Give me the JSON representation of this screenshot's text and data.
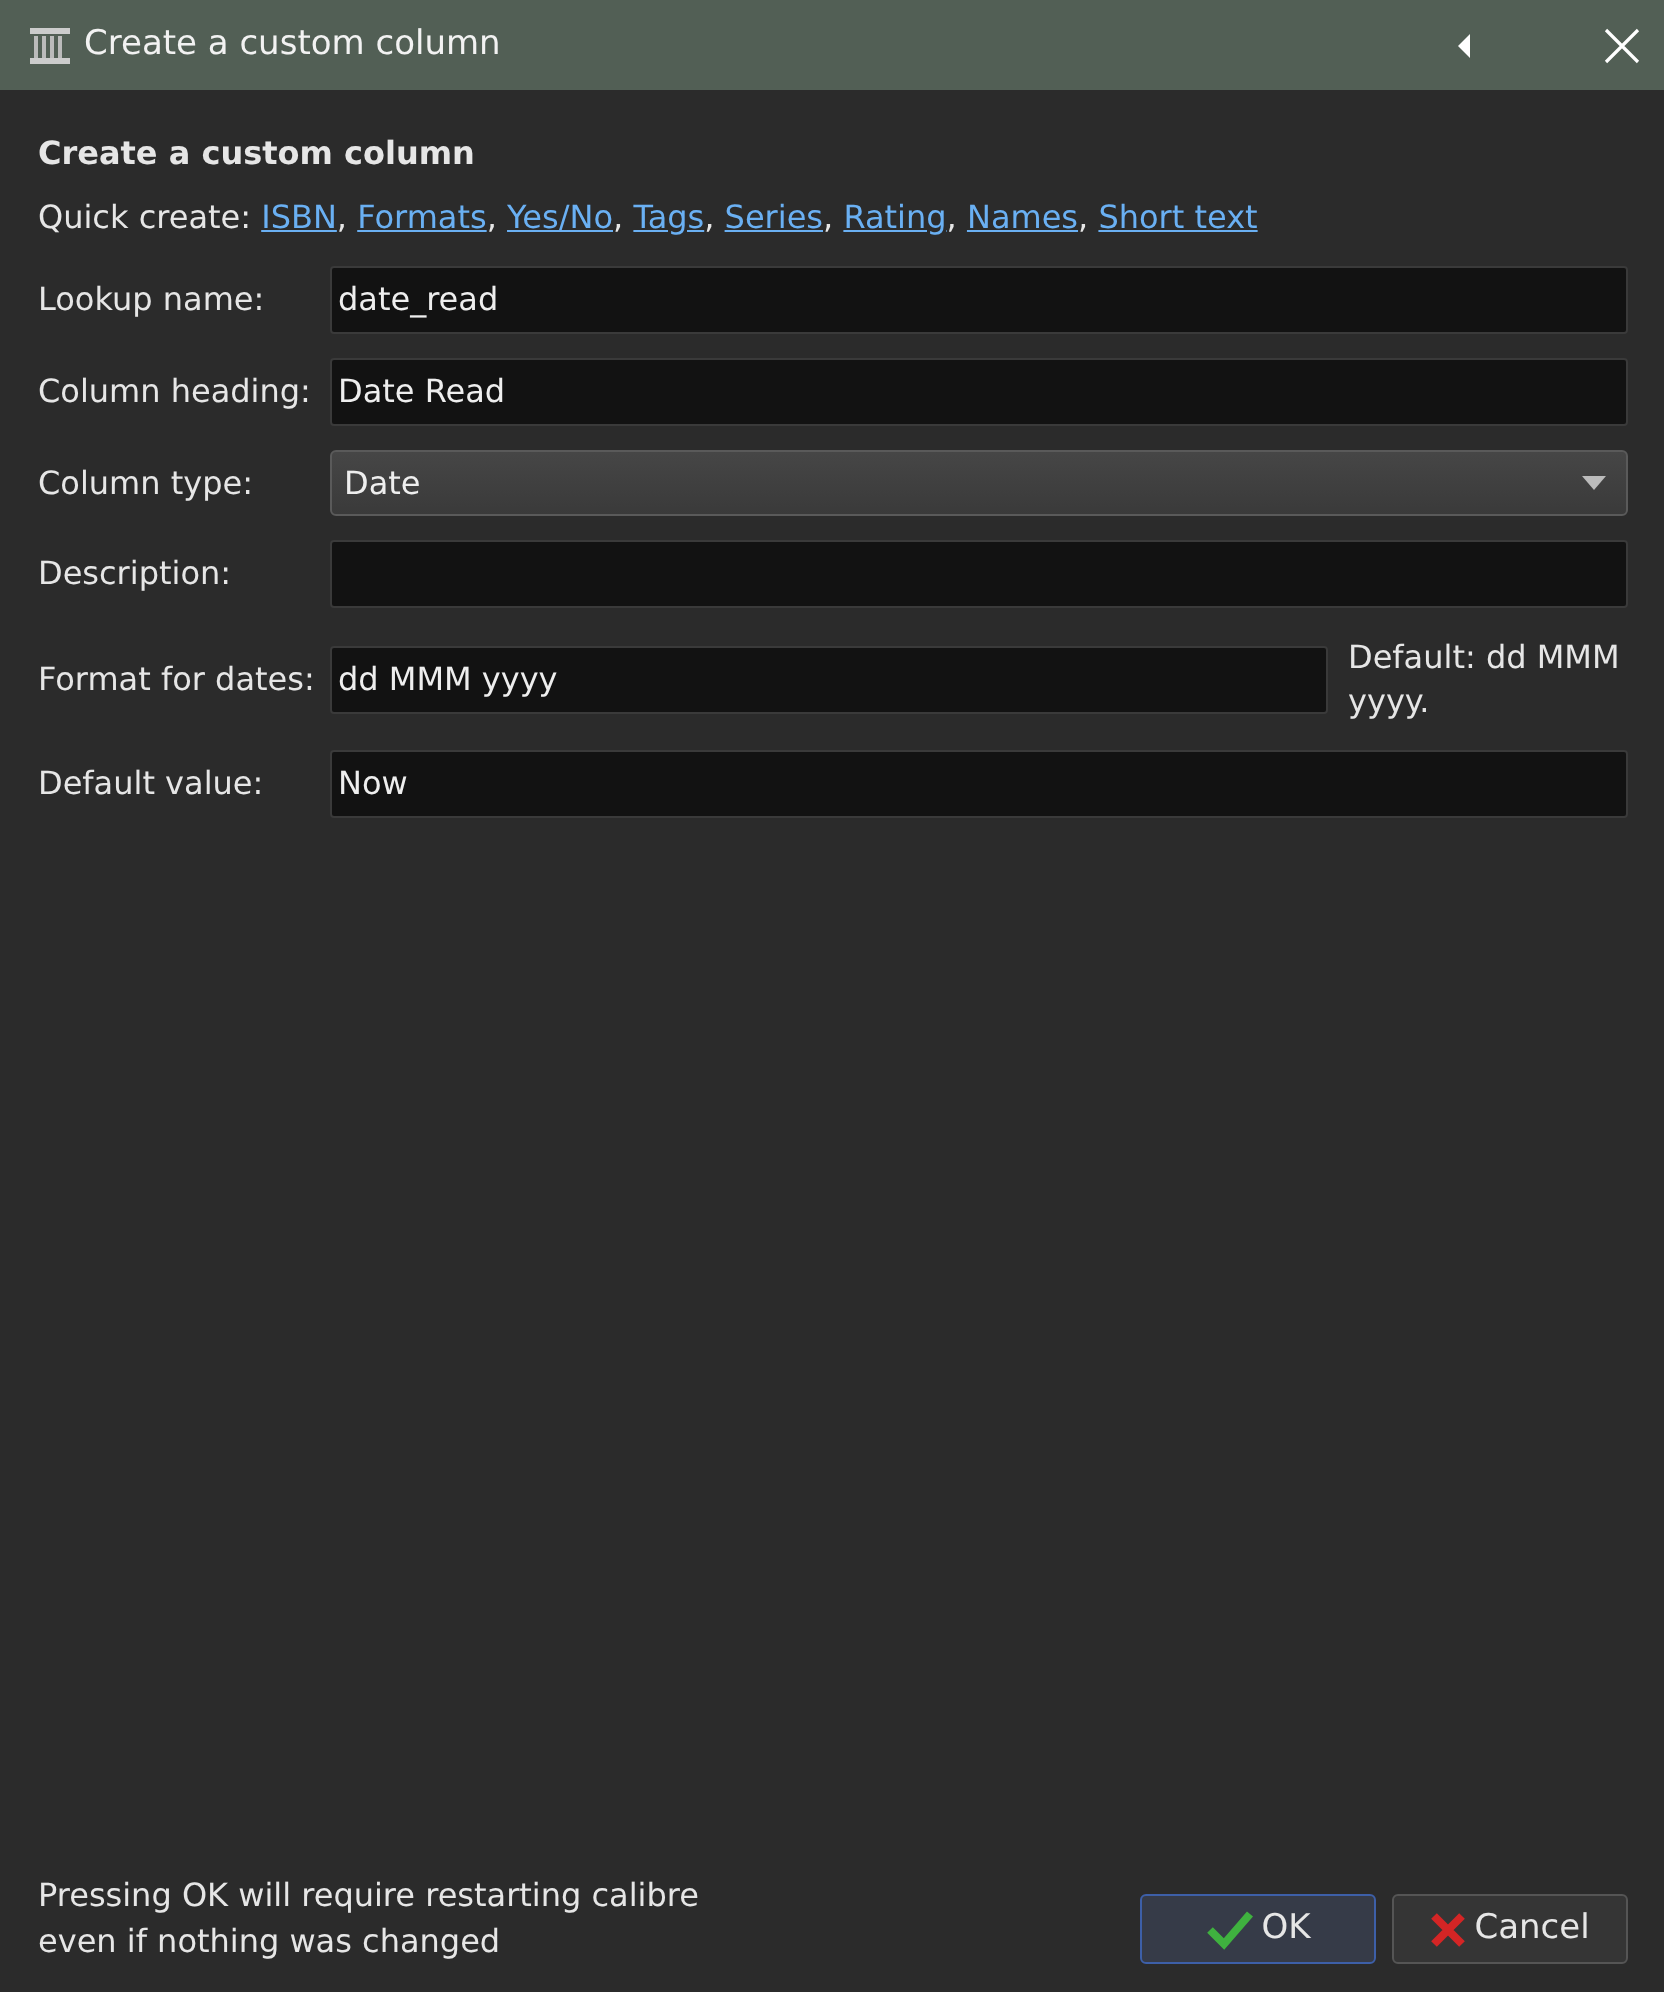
{
  "window": {
    "title": "Create a custom column"
  },
  "heading": "Create a custom column",
  "quick_create": {
    "label": "Quick create:",
    "links": [
      {
        "label": "ISBN",
        "separator": ","
      },
      {
        "label": "Formats",
        "separator": ","
      },
      {
        "label": "Yes/No",
        "separator": ","
      },
      {
        "label": "Tags",
        "separator": ","
      },
      {
        "label": "Series",
        "separator": ","
      },
      {
        "label": "Rating",
        "separator": ","
      },
      {
        "label": "Names",
        "separator": ","
      },
      {
        "label": "Short text"
      }
    ]
  },
  "fields": [
    {
      "kind": "text",
      "label": "Lookup name:",
      "value": "date_read"
    },
    {
      "kind": "text",
      "label": "Column heading:",
      "value": "Date Read"
    },
    {
      "kind": "combo",
      "label": "Column type:",
      "value": "Date"
    },
    {
      "kind": "text",
      "label": "Description:"
    },
    {
      "kind": "text",
      "label": "Format for dates:",
      "value": "dd MMM yyyy",
      "hint": "Default: dd MMM yyyy."
    },
    {
      "kind": "text",
      "label": "Default value:",
      "value": "Now"
    }
  ],
  "note": "Pressing OK will require restarting calibre even if nothing was changed",
  "buttons": [
    {
      "kind": "ok",
      "label": "OK",
      "selected": true
    },
    {
      "kind": "cancel",
      "label": "Cancel",
      "selected": false
    }
  ]
}
